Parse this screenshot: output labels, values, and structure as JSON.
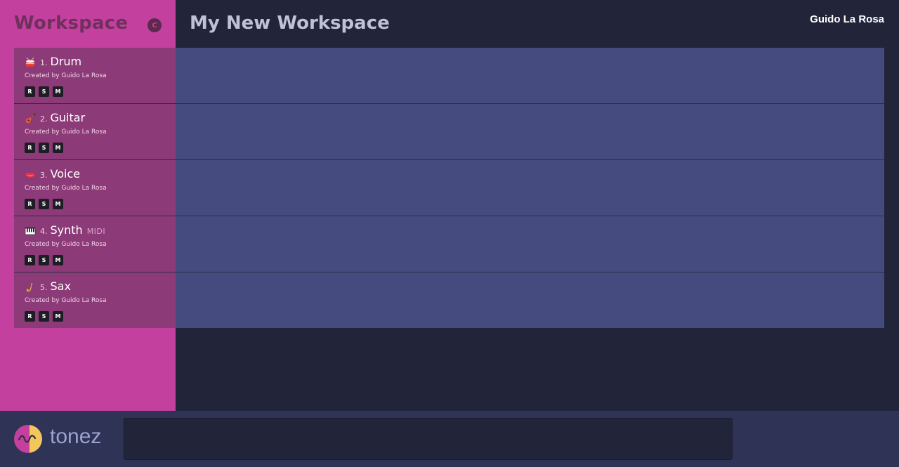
{
  "sidebar": {
    "title": "Workspace",
    "collapse_label": "C"
  },
  "header": {
    "workspace_title": "My New Workspace",
    "user": "Guido La Rosa"
  },
  "tracks": [
    {
      "icon": "drum-icon",
      "number": "1.",
      "name": "Drum",
      "tag": "",
      "creator": "Created by Guido La Rosa",
      "rec": "R",
      "solo": "S",
      "mute": "M"
    },
    {
      "icon": "guitar-icon",
      "number": "2.",
      "name": "Guitar",
      "tag": "",
      "creator": "Created by Guido La Rosa",
      "rec": "R",
      "solo": "S",
      "mute": "M"
    },
    {
      "icon": "lips-icon",
      "number": "3.",
      "name": "Voice",
      "tag": "",
      "creator": "Created by Guido La Rosa",
      "rec": "R",
      "solo": "S",
      "mute": "M"
    },
    {
      "icon": "piano-icon",
      "number": "4.",
      "name": "Synth",
      "tag": "MIDI",
      "creator": "Created by Guido La Rosa",
      "rec": "R",
      "solo": "S",
      "mute": "M"
    },
    {
      "icon": "saxophone-icon",
      "number": "5.",
      "name": "Sax",
      "tag": "",
      "creator": "Created by Guido La Rosa",
      "rec": "R",
      "solo": "S",
      "mute": "M"
    }
  ],
  "footer": {
    "brand": "tonez",
    "console_value": ""
  },
  "colors": {
    "sidebar": "#c4409f",
    "track_head": "#8d3a78",
    "track_lane": "#454b7f",
    "background": "#22243a",
    "footer": "#2f3356"
  }
}
